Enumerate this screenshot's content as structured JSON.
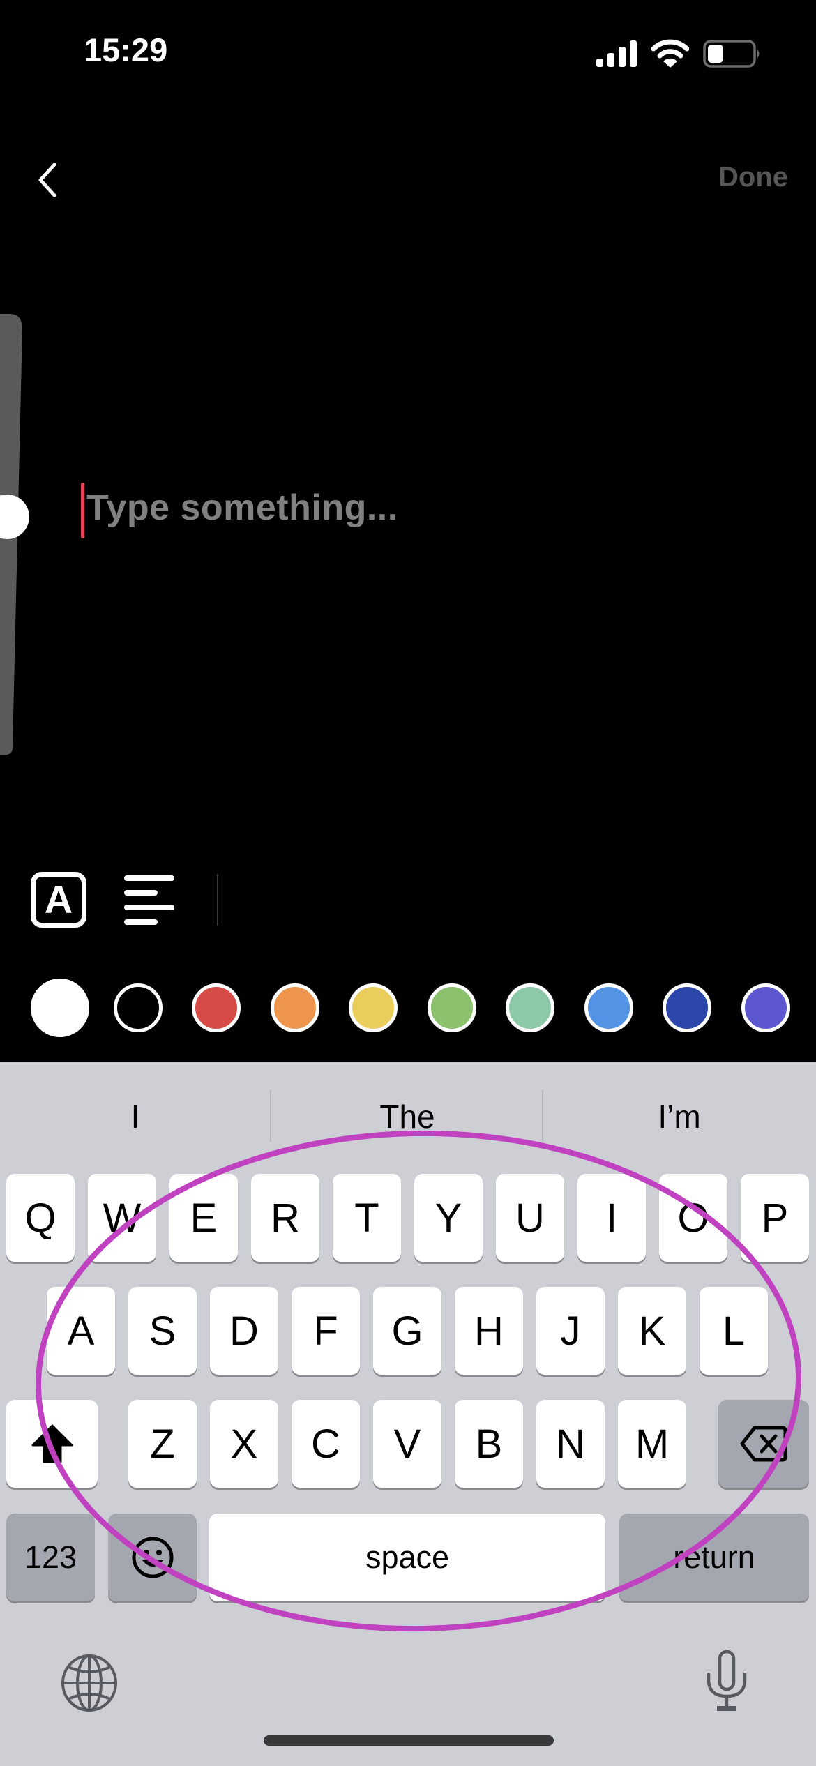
{
  "status_bar": {
    "time": "15:29",
    "signal_icon": "cellular-signal-icon",
    "wifi_icon": "wifi-icon",
    "battery_icon": "battery-icon",
    "battery_level": 0.35
  },
  "header": {
    "back_icon": "chevron-left-icon",
    "done_label": "Done",
    "done_color": "#565656"
  },
  "editor": {
    "placeholder": "Type something...",
    "placeholder_color": "#808080",
    "caret_color": "#e8445a",
    "size_slider_value": 0.46
  },
  "toolbar": {
    "text_style_label": "A",
    "text_style_icon": "text-style-icon",
    "align_icon": "align-left-icon"
  },
  "colors": [
    {
      "name": "white",
      "hex": "#ffffff",
      "selected": true
    },
    {
      "name": "black",
      "hex": "#000000",
      "selected": false
    },
    {
      "name": "red",
      "hex": "#d74b47",
      "selected": false
    },
    {
      "name": "orange",
      "hex": "#ee964e",
      "selected": false
    },
    {
      "name": "yellow",
      "hex": "#ebcd5b",
      "selected": false
    },
    {
      "name": "green",
      "hex": "#8bc06c",
      "selected": false
    },
    {
      "name": "mint",
      "hex": "#8dc8a8",
      "selected": false
    },
    {
      "name": "light-blue",
      "hex": "#5393e6",
      "selected": false
    },
    {
      "name": "dark-blue",
      "hex": "#2d46ac",
      "selected": false
    },
    {
      "name": "purple",
      "hex": "#5c57cf",
      "selected": false
    }
  ],
  "keyboard": {
    "suggestions": [
      "I",
      "The",
      "I’m"
    ],
    "rows": [
      [
        "Q",
        "W",
        "E",
        "R",
        "T",
        "Y",
        "U",
        "I",
        "O",
        "P"
      ],
      [
        "A",
        "S",
        "D",
        "F",
        "G",
        "H",
        "J",
        "K",
        "L"
      ],
      [
        "Z",
        "X",
        "C",
        "V",
        "B",
        "N",
        "M"
      ]
    ],
    "shift_icon": "shift-icon",
    "delete_icon": "delete-backspace-icon",
    "numbers_label": "123",
    "emoji_icon": "emoji-icon",
    "space_label": "space",
    "return_label": "return",
    "globe_icon": "globe-icon",
    "mic_icon": "microphone-icon"
  },
  "annotation": {
    "shape": "ellipse",
    "color": "#c042c0",
    "target": "keyboard letter keys"
  }
}
